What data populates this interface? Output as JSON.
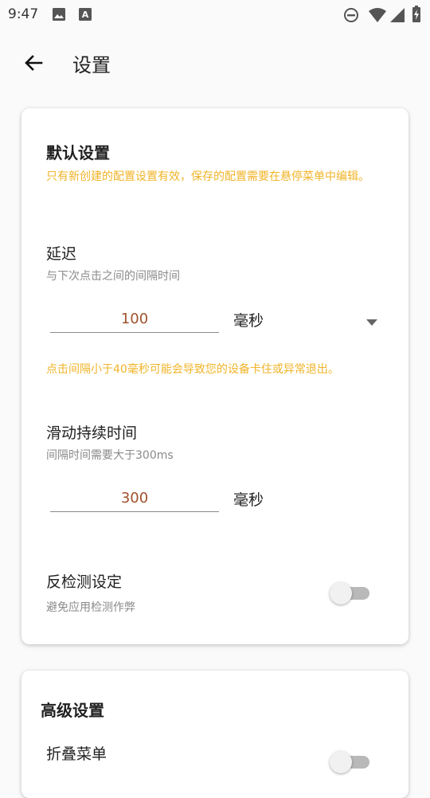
{
  "status_bar": {
    "time": "9:47",
    "left_icons": [
      "image-icon",
      "a-notification-icon"
    ],
    "right_icons": [
      "do-not-disturb-icon",
      "wifi-icon",
      "signal-icon",
      "battery-charging-icon"
    ]
  },
  "toolbar": {
    "title": "设置",
    "back_icon": "arrow-back-icon"
  },
  "default_settings": {
    "title": "默认设置",
    "warning": "只有新创建的配置设置有效，保存的配置需要在悬停菜单中编辑。",
    "delay": {
      "title": "延迟",
      "subtitle": "与下次点击之间的间隔时间",
      "value": "100",
      "unit": "毫秒",
      "warning": "点击间隔小于40毫秒可能会导致您的设备卡住或异常退出。"
    },
    "swipe_duration": {
      "title": "滑动持续时间",
      "subtitle": "间隔时间需要大于300ms",
      "value": "300",
      "unit": "毫秒"
    },
    "anti_detection": {
      "title": "反检测设定",
      "subtitle": "避免应用检测作弊",
      "enabled": false
    }
  },
  "advanced_settings": {
    "title": "高级设置",
    "collapse_menu": {
      "title": "折叠菜单",
      "enabled": false
    }
  },
  "colors": {
    "warning": "#f0b429",
    "input_value": "#a0522d",
    "toggle_off_track": "#b9b9b9"
  }
}
